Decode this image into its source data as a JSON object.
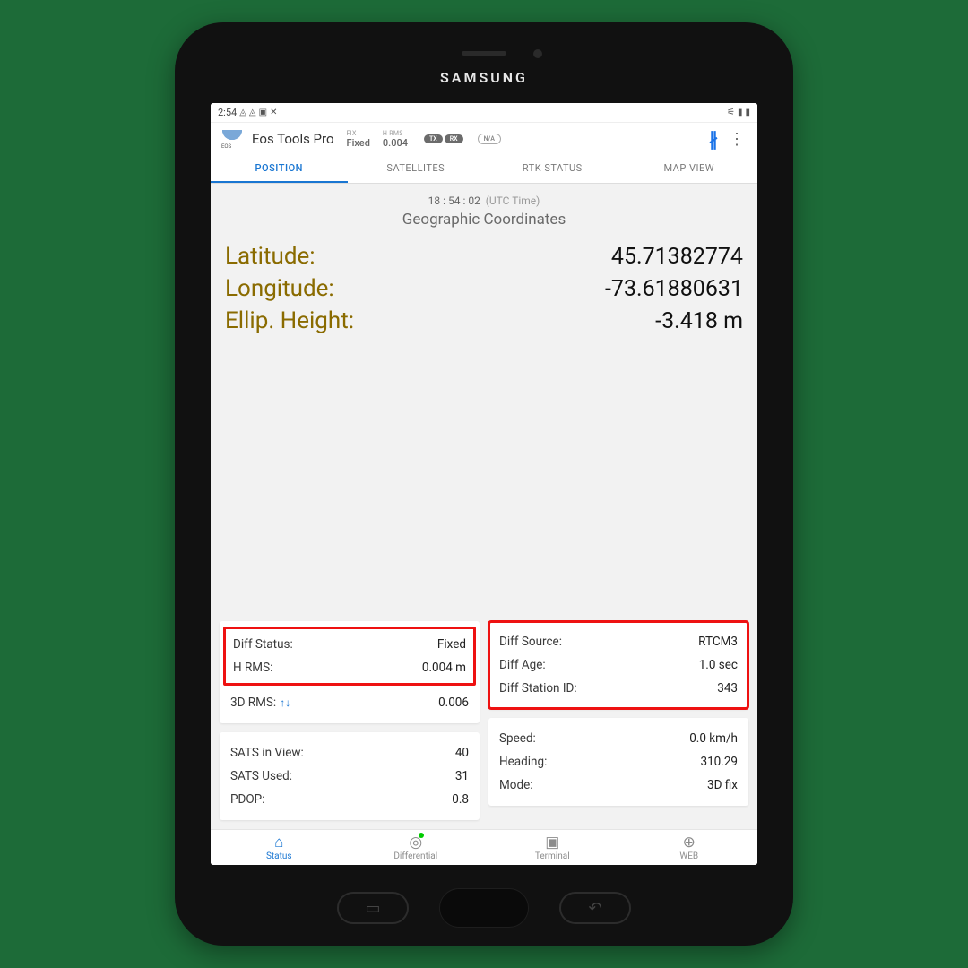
{
  "device_brand": "SAMSUNG",
  "statusbar": {
    "time": "2:54"
  },
  "header": {
    "app_title": "Eos Tools Pro",
    "fix_label": "FIX",
    "fix_value": "Fixed",
    "hrms_label": "H RMS",
    "hrms_value": "0.004",
    "tx": "TX",
    "rx": "RX",
    "na": "N/A"
  },
  "tabs": {
    "position": "POSITION",
    "satellites": "SATELLITES",
    "rtk": "RTK STATUS",
    "map": "MAP VIEW"
  },
  "utc": {
    "time": "18 : 54 : 02",
    "label": "(UTC Time)"
  },
  "section_title": "Geographic Coordinates",
  "coords": {
    "lat_label": "Latitude:",
    "lat_value": "45.71382774",
    "lon_label": "Longitude:",
    "lon_value": "-73.61880631",
    "eh_label": "Ellip. Height:",
    "eh_value": "-3.418 m"
  },
  "card_a": {
    "diff_status_k": "Diff Status:",
    "diff_status_v": "Fixed",
    "hrms_k": "H RMS:",
    "hrms_v": "0.004 m",
    "rms3d_k": "3D RMS:",
    "rms3d_v": "0.006"
  },
  "card_b": {
    "src_k": "Diff Source:",
    "src_v": "RTCM3",
    "age_k": "Diff Age:",
    "age_v": "1.0 sec",
    "sid_k": "Diff Station ID:",
    "sid_v": "343"
  },
  "card_c": {
    "view_k": "SATS in View:",
    "view_v": "40",
    "used_k": "SATS Used:",
    "used_v": "31",
    "pdop_k": "PDOP:",
    "pdop_v": "0.8"
  },
  "card_d": {
    "spd_k": "Speed:",
    "spd_v": "0.0 km/h",
    "hdg_k": "Heading:",
    "hdg_v": "310.29",
    "mode_k": "Mode:",
    "mode_v": "3D fix"
  },
  "bottomnav": {
    "status": "Status",
    "diff": "Differential",
    "term": "Terminal",
    "web": "WEB"
  }
}
